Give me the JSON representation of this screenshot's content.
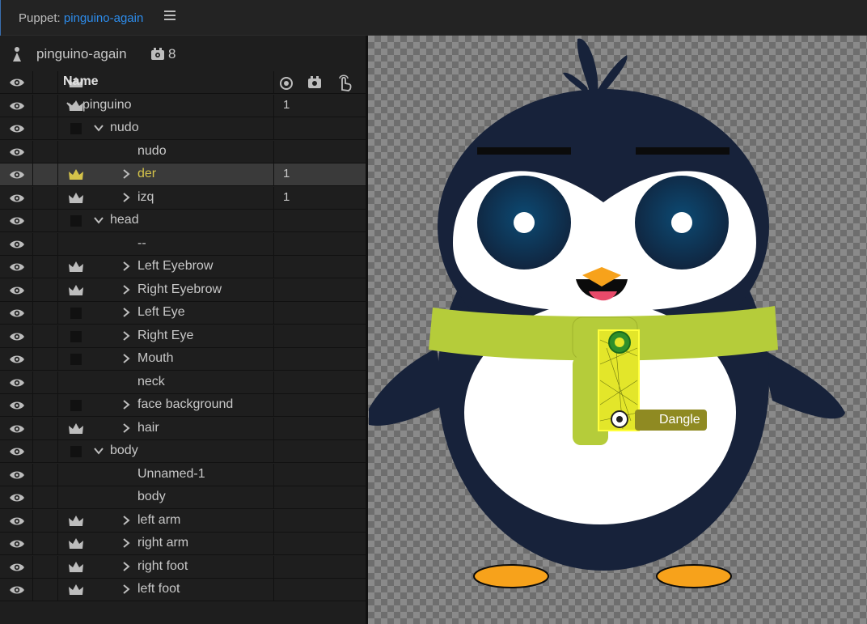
{
  "header": {
    "panel_label": "Puppet:",
    "puppet_title": "pinguino-again"
  },
  "puppet": {
    "name": "pinguino-again",
    "count": "8"
  },
  "columns": {
    "name": "Name"
  },
  "rows": [
    {
      "label": "pinguino",
      "indent": 1,
      "chev": "down",
      "eye": true,
      "crown": true,
      "num": "1"
    },
    {
      "label": "nudo",
      "indent": 2,
      "chev": "down",
      "eye": true,
      "box": true
    },
    {
      "label": "nudo",
      "indent": 3,
      "chev": "none",
      "eye": true
    },
    {
      "label": "der",
      "indent": 3,
      "chev": "right",
      "eye": true,
      "crown": "yellow",
      "num": "1",
      "selected": true
    },
    {
      "label": "izq",
      "indent": 3,
      "chev": "right",
      "eye": true,
      "crown": true,
      "num": "1"
    },
    {
      "label": "head",
      "indent": 2,
      "chev": "down",
      "eye": true,
      "box": true
    },
    {
      "label": "--",
      "indent": 3,
      "chev": "none",
      "eye": true
    },
    {
      "label": "Left Eyebrow",
      "indent": 3,
      "chev": "right",
      "eye": true,
      "crown": true
    },
    {
      "label": "Right Eyebrow",
      "indent": 3,
      "chev": "right",
      "eye": true,
      "crown": true
    },
    {
      "label": "Left Eye",
      "indent": 3,
      "chev": "right",
      "eye": true,
      "box": true
    },
    {
      "label": "Right Eye",
      "indent": 3,
      "chev": "right",
      "eye": true,
      "box": true
    },
    {
      "label": "Mouth",
      "indent": 3,
      "chev": "right",
      "eye": true,
      "box": true
    },
    {
      "label": "neck",
      "indent": 3,
      "chev": "none",
      "eye": true
    },
    {
      "label": "face background",
      "indent": 3,
      "chev": "right",
      "eye": true,
      "box": true
    },
    {
      "label": "hair",
      "indent": 3,
      "chev": "right",
      "eye": true,
      "crown": true
    },
    {
      "label": "body",
      "indent": 2,
      "chev": "down",
      "eye": true,
      "box": true
    },
    {
      "label": "Unnamed-1",
      "indent": 3,
      "chev": "none",
      "eye": true
    },
    {
      "label": "body",
      "indent": 3,
      "chev": "none",
      "eye": true
    },
    {
      "label": "left arm",
      "indent": 3,
      "chev": "right",
      "eye": true,
      "crown": true
    },
    {
      "label": "right arm",
      "indent": 3,
      "chev": "right",
      "eye": true,
      "crown": true
    },
    {
      "label": "right foot",
      "indent": 3,
      "chev": "right",
      "eye": true,
      "crown": true
    },
    {
      "label": "left foot",
      "indent": 3,
      "chev": "right",
      "eye": true,
      "crown": true
    }
  ],
  "canvas": {
    "tag_label": "Dangle"
  },
  "colors": {
    "accent_blue": "#2d8ceb",
    "select_yellow": "#d4c24a",
    "penguin_navy": "#17223a",
    "scarf_green": "#b5cc3a",
    "beak_orange": "#f7a21b"
  }
}
